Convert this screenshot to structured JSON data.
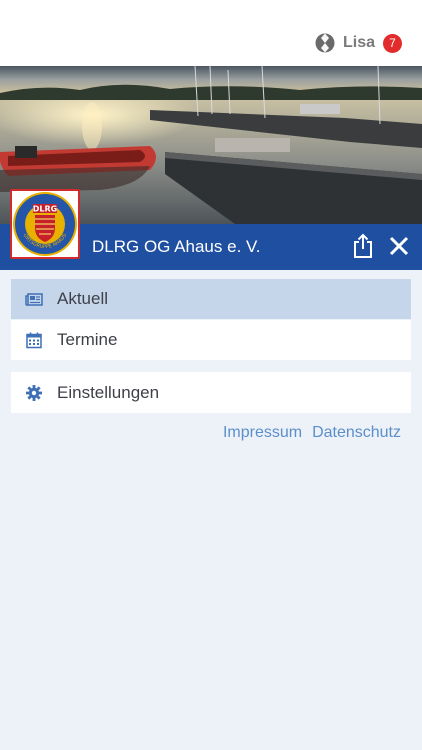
{
  "header": {
    "user_name": "Lisa",
    "notification_count": "7"
  },
  "org": {
    "name": "DLRG OG Ahaus e. V.",
    "logo_text": "DLRG",
    "logo_ring_text": "ORTSGRUPPE AHAUS"
  },
  "menu": {
    "items": [
      {
        "label": "Aktuell",
        "icon": "newspaper-icon",
        "active": true
      },
      {
        "label": "Termine",
        "icon": "calendar-icon",
        "active": false
      }
    ],
    "settings": {
      "label": "Einstellungen",
      "icon": "gear-icon"
    }
  },
  "footer_links": {
    "impressum": "Impressum",
    "datenschutz": "Datenschutz"
  },
  "colors": {
    "brand_blue": "#1f4fa0",
    "active_row": "#c5d5ea",
    "badge_red": "#e22b2b",
    "link": "#5c8fca",
    "background": "#edf1f8"
  }
}
